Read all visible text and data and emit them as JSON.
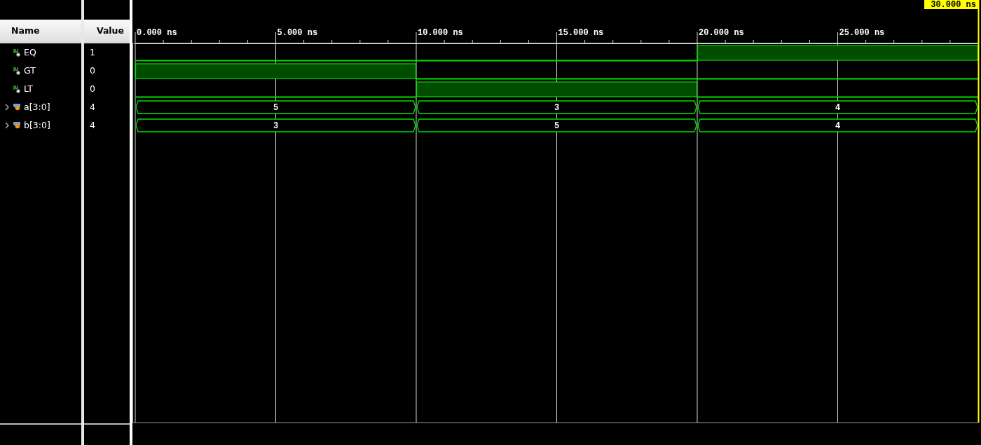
{
  "columns": {
    "name": "Name",
    "value": "Value"
  },
  "cursor": {
    "label": "30.000 ns"
  },
  "timeline": {
    "ticks": [
      "0.000 ns",
      "5.000 ns",
      "10.000 ns",
      "15.000 ns",
      "20.000 ns",
      "25.000 ns"
    ]
  },
  "signals": [
    {
      "name": "EQ",
      "kind": "bit",
      "value": "1",
      "segments": [
        {
          "high": false
        },
        {
          "high": false
        },
        {
          "high": true
        }
      ]
    },
    {
      "name": "GT",
      "kind": "bit",
      "value": "0",
      "segments": [
        {
          "high": true
        },
        {
          "high": false
        },
        {
          "high": false
        }
      ]
    },
    {
      "name": "LT",
      "kind": "bit",
      "value": "0",
      "segments": [
        {
          "high": false
        },
        {
          "high": true
        },
        {
          "high": false
        }
      ]
    },
    {
      "name": "a[3:0]",
      "kind": "bus",
      "value": "4",
      "expanded": false,
      "segments": [
        {
          "value": "5"
        },
        {
          "value": "3"
        },
        {
          "value": "4"
        }
      ]
    },
    {
      "name": "b[3:0]",
      "kind": "bus",
      "value": "4",
      "expanded": false,
      "segments": [
        {
          "value": "3"
        },
        {
          "value": "5"
        },
        {
          "value": "4"
        }
      ]
    }
  ]
}
